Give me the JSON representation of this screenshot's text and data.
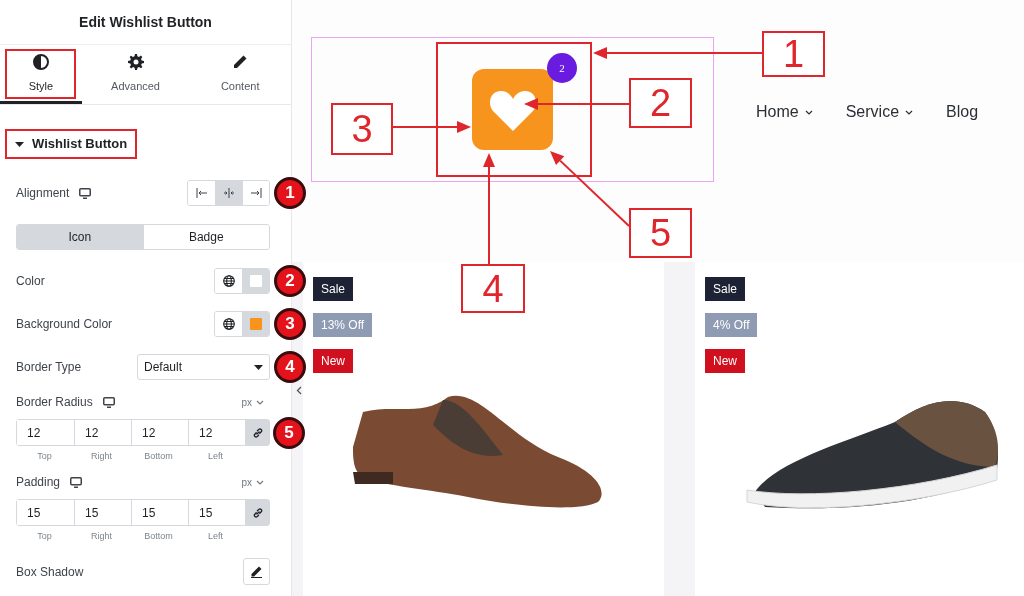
{
  "panel": {
    "title": "Edit Wishlist Button",
    "tabs": [
      {
        "label": "Style",
        "selected": true
      },
      {
        "label": "Advanced",
        "selected": false
      },
      {
        "label": "Content",
        "selected": false
      }
    ],
    "section": {
      "title": "Wishlist Button",
      "expanded": true,
      "highlighted": true
    },
    "controls": [
      {
        "kind": "align",
        "label": "Alignment",
        "responsive": true,
        "marker": "1",
        "options": [
          {
            "selected": false
          },
          {
            "selected": true
          },
          {
            "selected": false
          }
        ]
      },
      {
        "kind": "segmented",
        "options": [
          {
            "label": "Icon",
            "selected": true
          },
          {
            "label": "Badge",
            "selected": false
          }
        ]
      },
      {
        "kind": "color",
        "label": "Color",
        "color": "#ffffff",
        "marker": "2"
      },
      {
        "kind": "color",
        "label": "Background Color",
        "color": "#f7941d",
        "marker": "3"
      },
      {
        "kind": "select",
        "label": "Border Type",
        "value": "Default",
        "marker": "4"
      },
      {
        "kind": "dimensions",
        "label": "Border Radius",
        "responsive": true,
        "unit": "px",
        "linked": true,
        "marker": "5",
        "fields": [
          {
            "value": "12",
            "label": "Top"
          },
          {
            "value": "12",
            "label": "Right"
          },
          {
            "value": "12",
            "label": "Bottom"
          },
          {
            "value": "12",
            "label": "Left"
          }
        ]
      },
      {
        "kind": "dimensions",
        "label": "Padding",
        "responsive": true,
        "unit": "px",
        "linked": true,
        "fields": [
          {
            "value": "15",
            "label": "Top"
          },
          {
            "value": "15",
            "label": "Right"
          },
          {
            "value": "15",
            "label": "Bottom"
          },
          {
            "value": "15",
            "label": "Left"
          }
        ]
      },
      {
        "kind": "edit",
        "label": "Box Shadow"
      }
    ]
  },
  "preview": {
    "wishlist_count": "2",
    "nav": [
      {
        "label": "Home",
        "dropdown": true
      },
      {
        "label": "Service",
        "dropdown": true
      },
      {
        "label": "Blog",
        "dropdown": false
      }
    ],
    "callouts": [
      "1",
      "2",
      "3",
      "4",
      "5"
    ],
    "products": [
      {
        "tags": [
          {
            "label": "Sale",
            "kind": "sale"
          },
          {
            "label": "13% Off",
            "kind": "discount"
          },
          {
            "label": "New",
            "kind": "new"
          }
        ]
      },
      {
        "tags": [
          {
            "label": "Sale",
            "kind": "sale"
          },
          {
            "label": "4% Off",
            "kind": "discount"
          },
          {
            "label": "New",
            "kind": "new"
          }
        ]
      }
    ]
  }
}
